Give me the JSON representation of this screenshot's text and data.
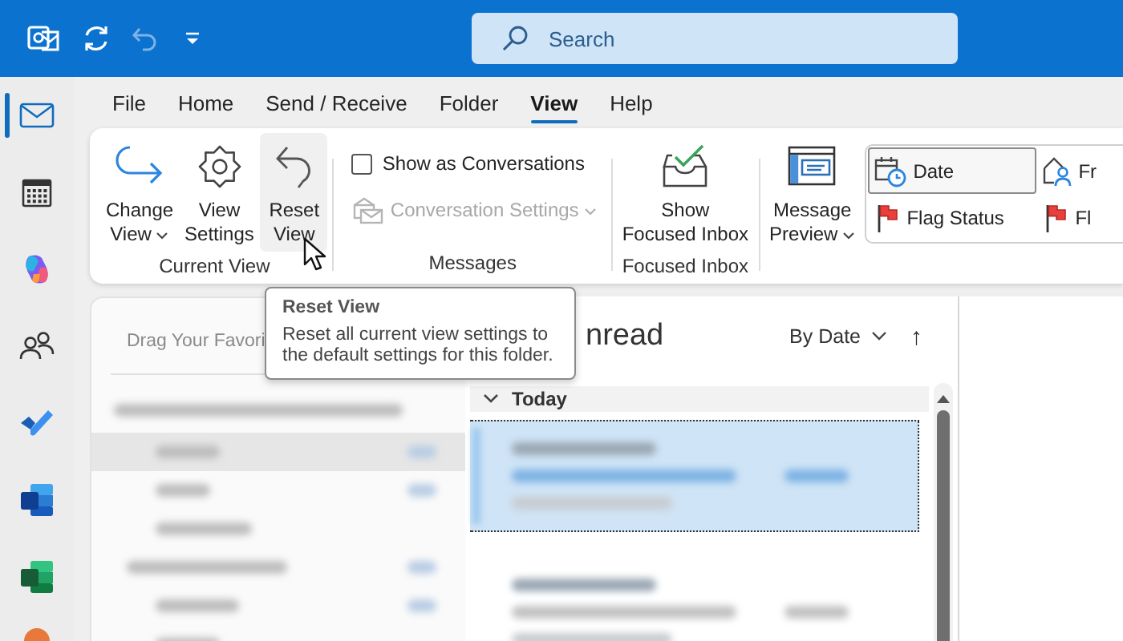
{
  "title_bar": {
    "quick_access": [
      {
        "kind": "app",
        "disabled": false
      },
      {
        "kind": "sync",
        "disabled": false
      },
      {
        "kind": "undo",
        "disabled": true
      },
      {
        "kind": "customize",
        "disabled": false
      }
    ],
    "search": {
      "placeholder": "Search"
    }
  },
  "nav_rail": [
    {
      "kind": "mail",
      "selected": true
    },
    {
      "kind": "calendar",
      "selected": false
    },
    {
      "kind": "copilot",
      "selected": false
    },
    {
      "kind": "people",
      "selected": false
    },
    {
      "kind": "todo",
      "selected": false
    },
    {
      "kind": "word",
      "selected": false
    },
    {
      "kind": "excel",
      "selected": false
    },
    {
      "kind": "more_app",
      "selected": false
    }
  ],
  "menu_tabs": [
    {
      "label": "File",
      "selected": false
    },
    {
      "label": "Home",
      "selected": false
    },
    {
      "label": "Send / Receive",
      "selected": false
    },
    {
      "label": "Folder",
      "selected": false
    },
    {
      "label": "View",
      "selected": true
    },
    {
      "label": "Help",
      "selected": false
    }
  ],
  "ribbon": {
    "groups": [
      {
        "label": "Current View",
        "controls": [
          {
            "kind": "change_view",
            "label": "Change\nView",
            "dropdown": true,
            "hovered": false
          },
          {
            "kind": "view_settings",
            "label": "View\nSettings",
            "dropdown": false,
            "hovered": false
          },
          {
            "kind": "reset_view",
            "label": "Reset\nView",
            "dropdown": false,
            "hovered": true
          }
        ]
      },
      {
        "label": "Messages",
        "controls": [
          {
            "kind": "conversations_toggle",
            "label": "Show as Conversations",
            "checked": false
          },
          {
            "kind": "conversation_settings",
            "label": "Conversation Settings",
            "dropdown": true,
            "disabled": true
          }
        ]
      },
      {
        "label": "Focused Inbox",
        "controls": [
          {
            "kind": "focused_inbox",
            "label": "Show\nFocused Inbox",
            "dropdown": false,
            "hovered": false
          }
        ]
      },
      {
        "controls": [
          {
            "kind": "message_preview",
            "label": "Message\nPreview",
            "dropdown": true,
            "hovered": false
          },
          {
            "kind": "arrangement",
            "options": [
              {
                "kind": "date",
                "label": "Date",
                "selected": true
              },
              {
                "kind": "flag",
                "label": "Flag Status",
                "selected": false
              },
              {
                "kind": "from",
                "label": "Fr",
                "selected": false
              },
              {
                "kind": "flag",
                "label": "Fl",
                "selected": false
              }
            ]
          }
        ]
      }
    ]
  },
  "folder_pane": {
    "favorites_hint": "Drag Your Favori",
    "rows": [
      {
        "kind": "account",
        "selected": false,
        "has_count": false
      },
      {
        "kind": "folder",
        "selected": true,
        "has_count": true
      },
      {
        "kind": "folder",
        "selected": false,
        "has_count": true
      },
      {
        "kind": "folder",
        "selected": false,
        "has_count": false
      },
      {
        "kind": "group",
        "selected": false,
        "has_count": true
      },
      {
        "kind": "folder",
        "selected": false,
        "has_count": true
      },
      {
        "kind": "folder",
        "selected": false,
        "has_count": false
      }
    ]
  },
  "message_list": {
    "title": "nread",
    "sort": "By Date",
    "sort_direction": "↑",
    "group": {
      "label": "Today",
      "expanded": true
    },
    "messages": [
      {
        "selected": true
      },
      {
        "selected": false
      }
    ]
  },
  "tooltip": {
    "title": "Reset View",
    "description": "Reset all current view settings to the default settings for this folder."
  }
}
